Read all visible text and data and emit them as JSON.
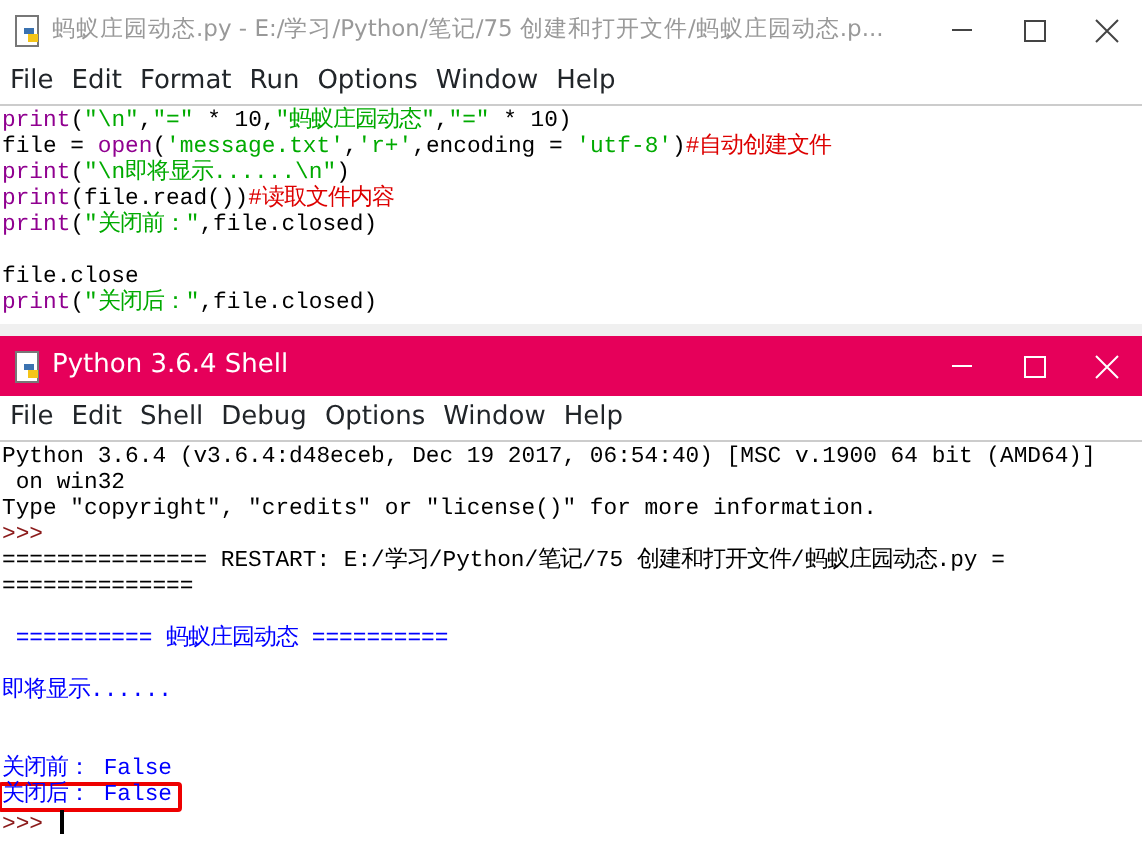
{
  "editor_window": {
    "title": "蚂蚁庄园动态.py - E:/学习/Python/笔记/75 创建和打开文件/蚂蚁庄园动态.p...",
    "active": false,
    "menu": [
      "File",
      "Edit",
      "Format",
      "Run",
      "Options",
      "Window",
      "Help"
    ],
    "code_lines": [
      {
        "tokens": [
          {
            "kind": "keyword",
            "text": "print"
          },
          {
            "kind": "plain",
            "text": "("
          },
          {
            "kind": "string",
            "text": "\"\\n\""
          },
          {
            "kind": "plain",
            "text": ","
          },
          {
            "kind": "string",
            "text": "\"=\""
          },
          {
            "kind": "plain",
            "text": " * 10,"
          },
          {
            "kind": "string",
            "text": "\"蚂蚁庄园动态\""
          },
          {
            "kind": "plain",
            "text": ","
          },
          {
            "kind": "string",
            "text": "\"=\""
          },
          {
            "kind": "plain",
            "text": " * 10)"
          }
        ]
      },
      {
        "tokens": [
          {
            "kind": "plain",
            "text": "file = "
          },
          {
            "kind": "keyword",
            "text": "open"
          },
          {
            "kind": "plain",
            "text": "("
          },
          {
            "kind": "string",
            "text": "'message.txt'"
          },
          {
            "kind": "plain",
            "text": ","
          },
          {
            "kind": "string",
            "text": "'r+'"
          },
          {
            "kind": "plain",
            "text": ",encoding = "
          },
          {
            "kind": "string",
            "text": "'utf-8'"
          },
          {
            "kind": "plain",
            "text": ")"
          },
          {
            "kind": "comment",
            "text": "#自动创建文件"
          }
        ]
      },
      {
        "tokens": [
          {
            "kind": "keyword",
            "text": "print"
          },
          {
            "kind": "plain",
            "text": "("
          },
          {
            "kind": "string",
            "text": "\"\\n即将显示......\\n\""
          },
          {
            "kind": "plain",
            "text": ")"
          }
        ]
      },
      {
        "tokens": [
          {
            "kind": "keyword",
            "text": "print"
          },
          {
            "kind": "plain",
            "text": "(file.read())"
          },
          {
            "kind": "comment",
            "text": "#读取文件内容"
          }
        ]
      },
      {
        "tokens": [
          {
            "kind": "keyword",
            "text": "print"
          },
          {
            "kind": "plain",
            "text": "("
          },
          {
            "kind": "string",
            "text": "\"关闭前：\""
          },
          {
            "kind": "plain",
            "text": ",file.closed)"
          }
        ]
      },
      {
        "kind": "blank"
      },
      {
        "tokens": [
          {
            "kind": "plain",
            "text": "file.close"
          }
        ]
      },
      {
        "tokens": [
          {
            "kind": "keyword",
            "text": "print"
          },
          {
            "kind": "plain",
            "text": "("
          },
          {
            "kind": "string",
            "text": "\"关闭后：\""
          },
          {
            "kind": "plain",
            "text": ",file.closed)"
          }
        ]
      }
    ]
  },
  "shell_window": {
    "title": "Python 3.6.4 Shell",
    "active": true,
    "menu": [
      "File",
      "Edit",
      "Shell",
      "Debug",
      "Options",
      "Window",
      "Help"
    ],
    "lines": [
      {
        "kind": "plain",
        "text": "Python 3.6.4 (v3.6.4:d48eceb, Dec 19 2017, 06:54:40) [MSC v.1900 64 bit (AMD64)]",
        "highlighted": false
      },
      {
        "kind": "plain",
        "text": " on win32",
        "highlighted": false
      },
      {
        "kind": "plain",
        "text": "Type \"copyright\", \"credits\" or \"license()\" for more information.",
        "highlighted": false
      },
      {
        "kind": "prompt",
        "text": ">>>",
        "highlighted": false
      },
      {
        "kind": "plain",
        "text": "=============== RESTART: E:/学习/Python/笔记/75 创建和打开文件/蚂蚁庄园动态.py =",
        "highlighted": false
      },
      {
        "kind": "plain",
        "text": "==============",
        "highlighted": false
      },
      {
        "kind": "blank"
      },
      {
        "kind": "output",
        "text": " ========== 蚂蚁庄园动态 ==========",
        "highlighted": false
      },
      {
        "kind": "blank"
      },
      {
        "kind": "output",
        "text": "即将显示......",
        "highlighted": false
      },
      {
        "kind": "blank"
      },
      {
        "kind": "blank"
      },
      {
        "kind": "output",
        "text": "关闭前： False",
        "highlighted": false
      },
      {
        "kind": "output",
        "text": "关闭后： False",
        "highlighted": true
      },
      {
        "kind": "cursor",
        "text": ">>>",
        "highlighted": false
      }
    ]
  }
}
